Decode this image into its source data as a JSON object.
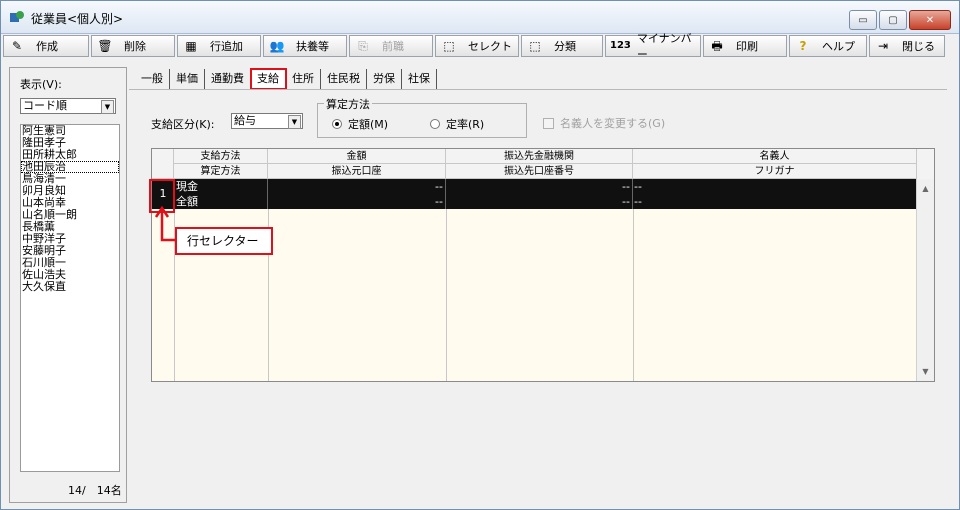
{
  "window": {
    "title": "従業員<個人別>",
    "controls": {
      "minimize": "▭",
      "maximize": "▢",
      "close": "✕"
    }
  },
  "toolbar": [
    {
      "label": "作成",
      "icon": "create-icon",
      "glyph": "✎",
      "enabled": true
    },
    {
      "label": "削除",
      "icon": "delete-icon",
      "glyph": "🗑",
      "enabled": true
    },
    {
      "label": "行追加",
      "icon": "add-row-icon",
      "glyph": "▦",
      "enabled": true
    },
    {
      "label": "扶養等",
      "icon": "dependents-icon",
      "glyph": "👥",
      "enabled": true
    },
    {
      "label": "前職",
      "icon": "previous-job-icon",
      "glyph": "⎘",
      "enabled": false
    },
    {
      "label": "セレクト",
      "icon": "select-icon",
      "glyph": "⬚",
      "enabled": true
    },
    {
      "label": "分類",
      "icon": "category-icon",
      "glyph": "⬚",
      "enabled": true
    },
    {
      "label": "マイナンバー",
      "icon": "mynumber-icon",
      "glyph": "123",
      "enabled": true
    },
    {
      "label": "印刷",
      "icon": "print-icon",
      "glyph": "🖶",
      "enabled": true
    },
    {
      "label": "ヘルプ",
      "icon": "help-icon",
      "glyph": "?",
      "enabled": true
    },
    {
      "label": "閉じる",
      "icon": "close-window-icon",
      "glyph": "⇥",
      "enabled": true
    }
  ],
  "left_pane": {
    "display_label": "表示(V):",
    "sort_value": "コード順",
    "employees": [
      "阿生憲司",
      "隆田孝子",
      "田所耕太郎",
      "池田辰治",
      "鳥海清一",
      "卯月良知",
      "山本尚幸",
      "山名順一朗",
      "長橋薫",
      "中野洋子",
      "安藤明子",
      "石川順一",
      "佐山浩夫",
      "大久保直"
    ],
    "focused_index": 3,
    "count_text": "14/　14名"
  },
  "tabs": [
    "一般",
    "単価",
    "通勤費",
    "支給",
    "住所",
    "住民税",
    "労保",
    "社保"
  ],
  "active_tab": 3,
  "form": {
    "pay_class_label": "支給区分(K):",
    "pay_class_value": "給与",
    "calc_method_title": "算定方法",
    "radio_fixed": "定額(M)",
    "radio_rate": "定率(R)",
    "radio_fixed_selected": true,
    "change_holder_label": "名義人を変更する(G)"
  },
  "grid": {
    "headers_top": [
      "支給方法",
      "金額",
      "振込先金融機関",
      "名義人"
    ],
    "headers_bottom": [
      "算定方法",
      "振込元口座",
      "振込先口座番号",
      "フリガナ"
    ],
    "row_selector": "1",
    "rows": [
      {
        "method": "現金",
        "amount": "--",
        "bank": "--",
        "holder": "--"
      },
      {
        "method": "全額",
        "amount": "--",
        "bank": "--",
        "holder": "--"
      }
    ],
    "scroll_up": "▲",
    "scroll_down": "▼"
  },
  "annotation": {
    "label": "行セレクター",
    "color": "#e0101a"
  }
}
